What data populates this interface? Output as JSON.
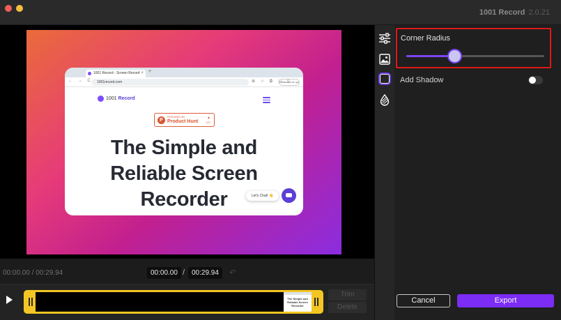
{
  "window": {
    "app_name": "1001 Record",
    "version": "2.0.21"
  },
  "preview": {
    "browser": {
      "tab_title": "1001 Record - Screen Record",
      "tab_close": "×",
      "new_tab": "+",
      "nav_icons": "← → C",
      "url": "1001record.com",
      "ext_icons": "⊕ ☆ ⧉ ⬚ ▯",
      "relaunch_label": "Relaunch to update"
    },
    "site": {
      "logo_prefix": "1001",
      "logo_name": "Record",
      "badge_small": "FEATURED ON",
      "badge_name": "Product Hunt",
      "badge_letter": "P",
      "badge_arrow": "▲",
      "badge_count": "127",
      "headline": [
        "The Simple and",
        "Reliable Screen",
        "Recorder"
      ],
      "chat_label": "Let's Chat! 👋"
    }
  },
  "playback": {
    "position_text": "00:00.00 / 00:29.94",
    "current": "00:00.00",
    "separator": "/",
    "duration": "00:29.94",
    "undo_glyph": "↶",
    "trim_label": "Trim",
    "delete_label": "Delete",
    "thumbnail_text": "The Simple and\nReliable Screen\nRecorder"
  },
  "settings": {
    "corner_radius_label": "Corner Radius",
    "corner_radius_value": 0.35,
    "add_shadow_label": "Add Shadow",
    "add_shadow_enabled": false
  },
  "footer": {
    "cancel_label": "Cancel",
    "export_label": "Export"
  },
  "colors": {
    "accent": "#7b2cf5",
    "highlight": "#e01818",
    "timeline_frame": "#f3c623"
  },
  "icons": {
    "rail": [
      "adjust-sliders-icon",
      "image-icon",
      "frame-icon",
      "drop-icon"
    ],
    "play": "play-icon",
    "undo": "undo-icon"
  }
}
